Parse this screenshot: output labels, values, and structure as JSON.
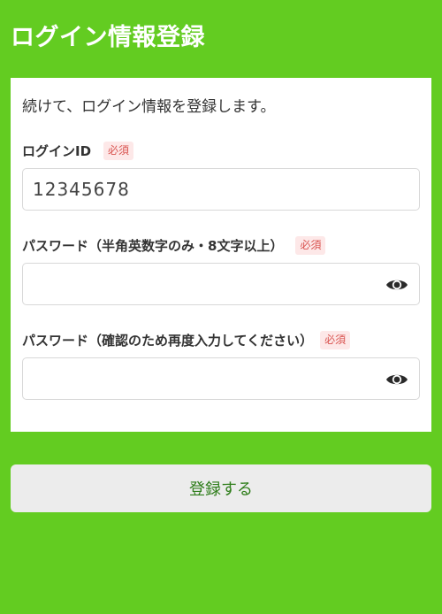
{
  "header": {
    "title": "ログイン情報登録"
  },
  "form": {
    "intro": "続けて、ログイン情報を登録します。",
    "required_label": "必須",
    "login_id": {
      "label": "ログインID",
      "value": "12345678"
    },
    "password": {
      "label": "パスワード（半角英数字のみ・8文字以上）",
      "value": "",
      "icon": "eye-icon"
    },
    "password_confirm": {
      "label": "パスワード（確認のため再度入力してください）",
      "value": "",
      "icon": "eye-icon"
    }
  },
  "actions": {
    "submit_label": "登録する"
  },
  "colors": {
    "background": "#63cc21",
    "required_badge_bg": "#fde8e8",
    "required_badge_text": "#d9534f",
    "button_text": "#2e7d1a"
  }
}
